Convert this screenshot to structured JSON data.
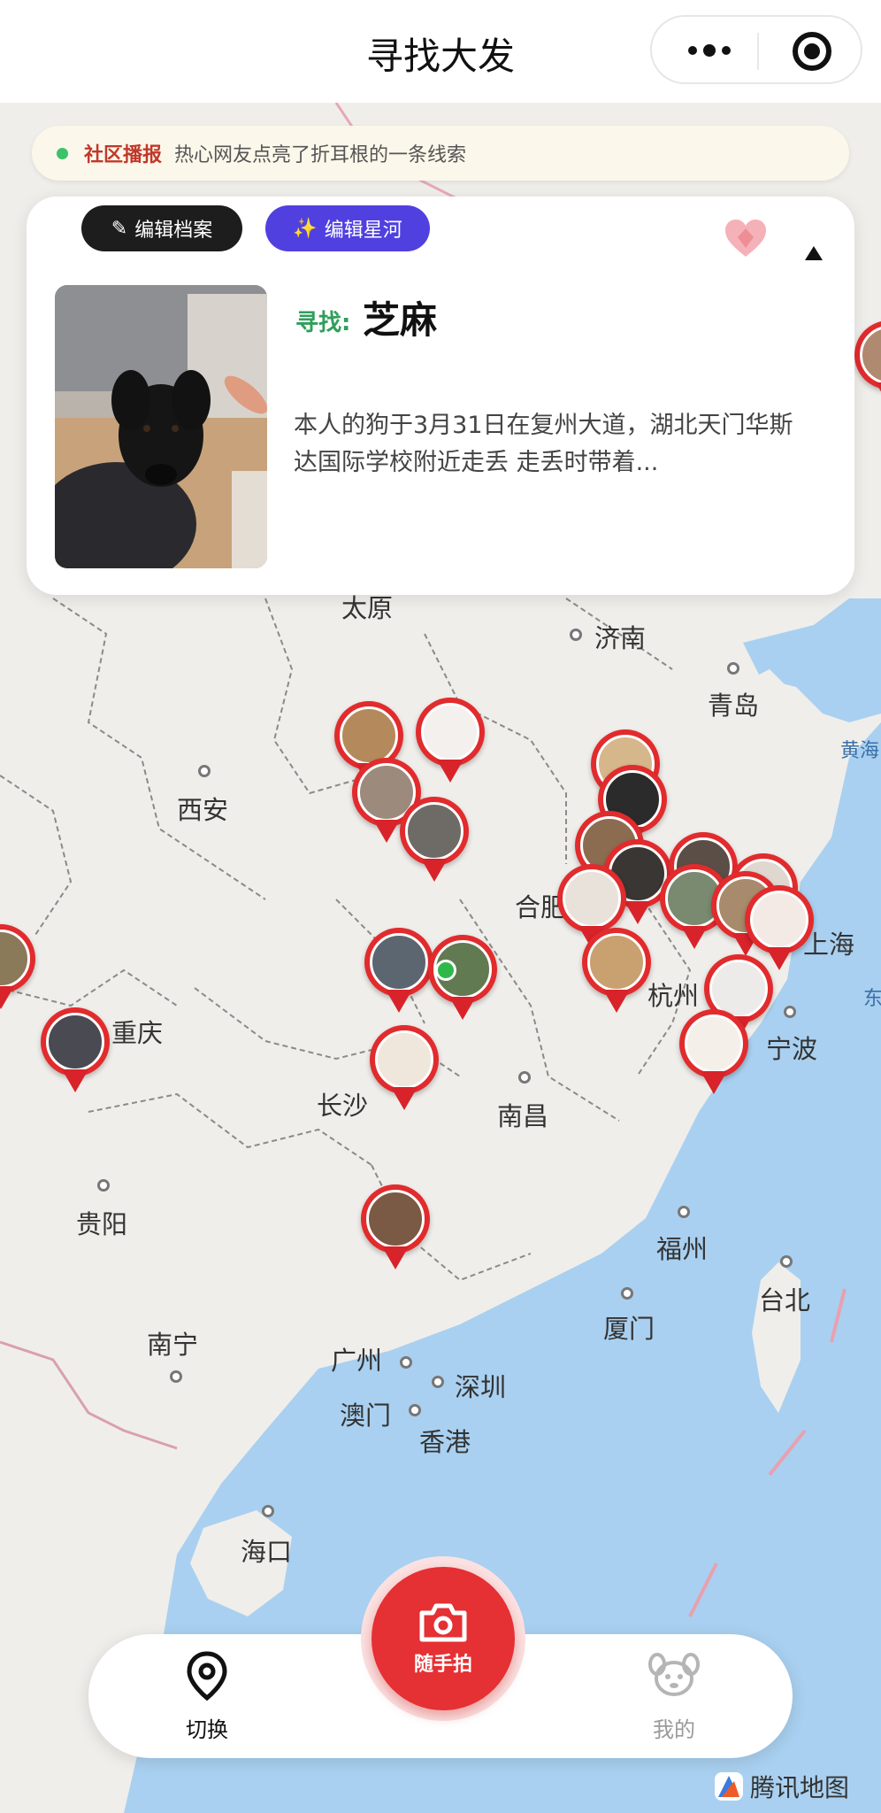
{
  "nav": {
    "title": "寻找大发"
  },
  "broadcast": {
    "tag": "社区播报",
    "text": "热心网友点亮了折耳根的一条线索"
  },
  "card": {
    "archive_button": "编辑档案",
    "star_button": "编辑星河",
    "find_label": "寻找:",
    "name": "芝麻",
    "description": "本人的狗于3月31日在复州大道，湖北天门华斯达国际学校附近走丢 走丢时带着..."
  },
  "map": {
    "cities": [
      "太原",
      "济南",
      "青岛",
      "西安",
      "合肥",
      "上海",
      "杭州",
      "宁波",
      "重庆",
      "长沙",
      "南昌",
      "贵阳",
      "福州",
      "台北",
      "厦门",
      "南宁",
      "广州",
      "深圳",
      "澳门",
      "香港",
      "海口"
    ],
    "sea_labels": [
      "黄海",
      "东"
    ],
    "accent_color": "#e12b2d"
  },
  "tabbar": {
    "switch_label": "切换",
    "camera_label": "随手拍",
    "mine_label": "我的"
  },
  "attribution": "腾讯地图"
}
